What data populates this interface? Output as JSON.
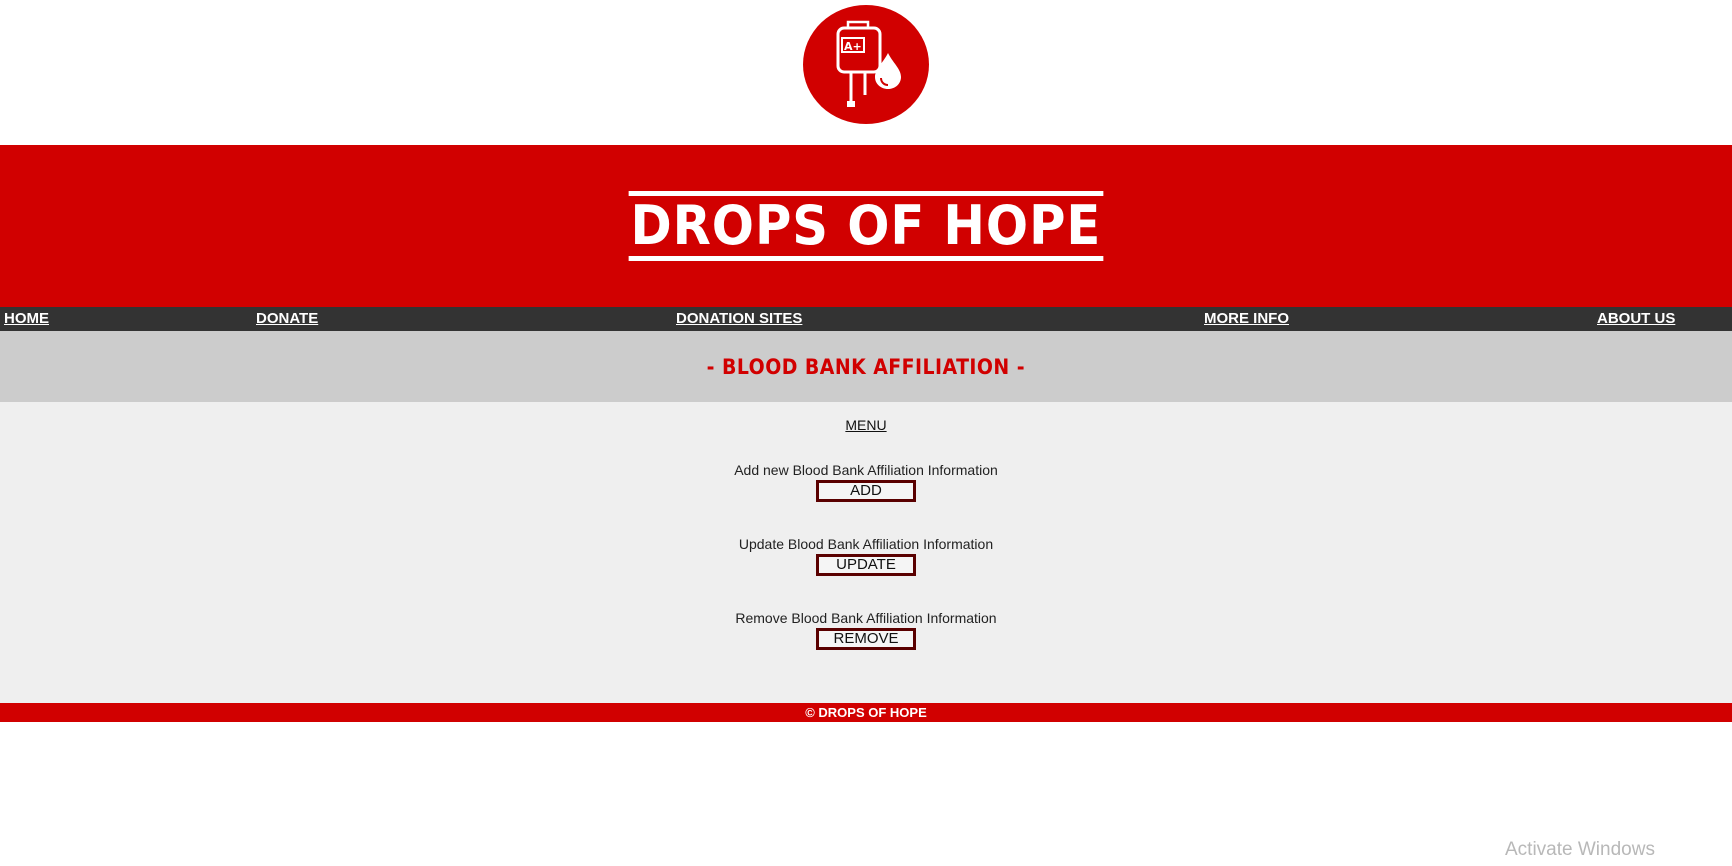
{
  "logo": {
    "icon": "blood-bag-icon",
    "bag_label": "A+",
    "color": "#d10000"
  },
  "banner": {
    "title": "DROPS OF HOPE",
    "color": "#d10000"
  },
  "nav": {
    "items": [
      {
        "label": "HOME"
      },
      {
        "label": "DONATE"
      },
      {
        "label": "DONATION SITES"
      },
      {
        "label": "MORE INFO"
      },
      {
        "label": "ABOUT US"
      }
    ]
  },
  "section": {
    "title": "- BLOOD BANK AFFILIATION -"
  },
  "menu": {
    "label": "MENU",
    "actions": [
      {
        "description": "Add new Blood Bank Affiliation Information",
        "button": "ADD"
      },
      {
        "description": "Update Blood Bank Affiliation Information",
        "button": "UPDATE"
      },
      {
        "description": "Remove Blood Bank Affiliation Information",
        "button": "REMOVE"
      }
    ]
  },
  "footer": {
    "text": "© DROPS OF HOPE"
  },
  "watermark": {
    "text": "Activate Windows"
  }
}
